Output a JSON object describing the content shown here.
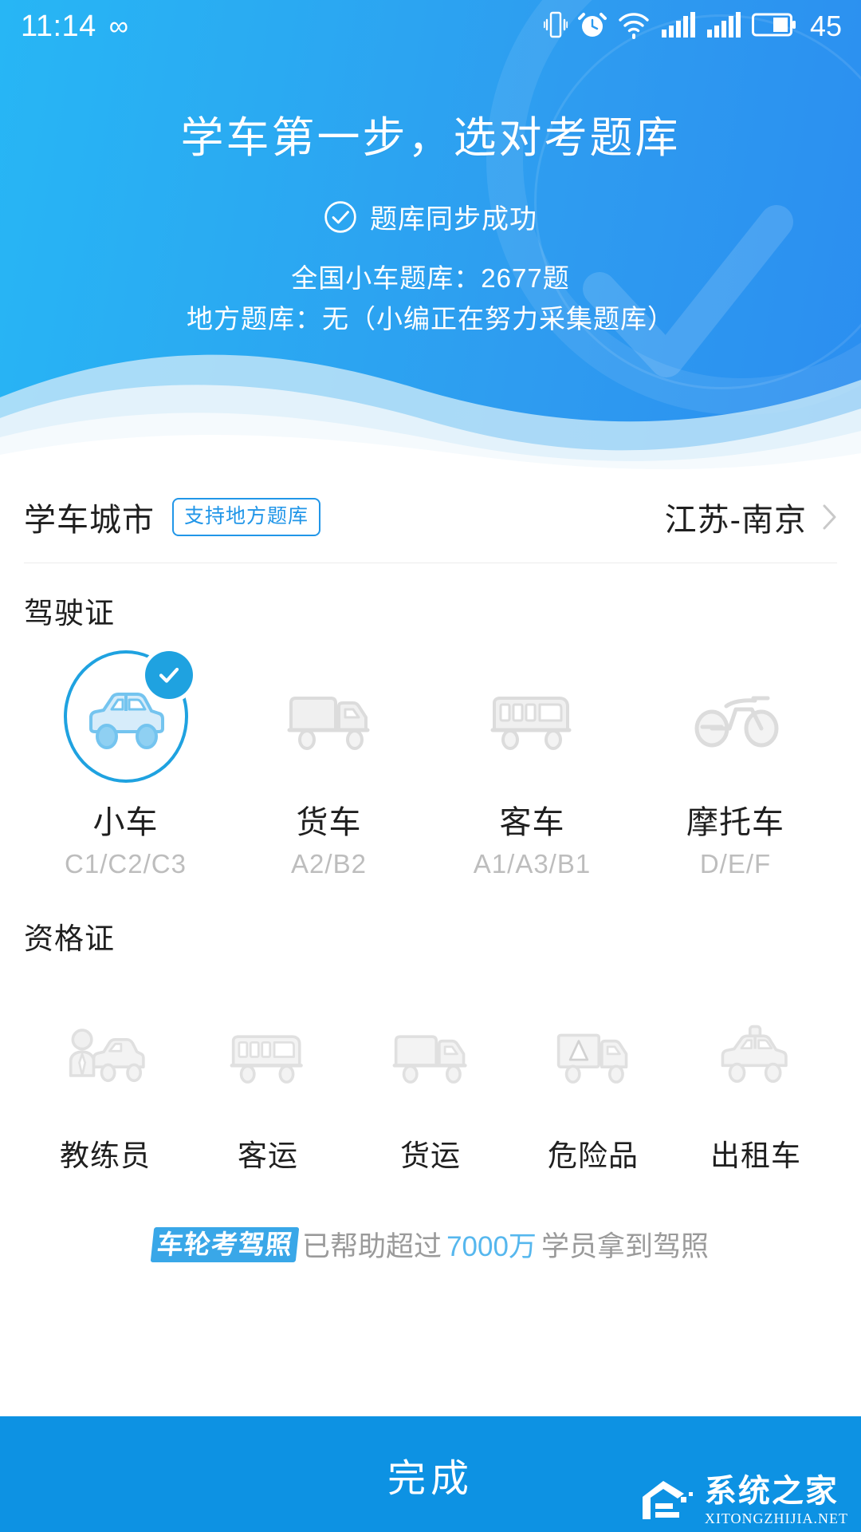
{
  "status_bar": {
    "time": "11:14",
    "infinity_glyph": "∞",
    "battery_level": "45",
    "icons": [
      "vibrate-icon",
      "alarm-icon",
      "wifi-icon",
      "signal-icon",
      "signal2-icon",
      "battery-icon"
    ]
  },
  "header": {
    "title": "学车第一步，选对考题库",
    "sync_status": "题库同步成功",
    "info_line_1": "全国小车题库：2677题",
    "info_line_2": "地方题库：无（小编正在努力采集题库）",
    "bank_count": "2677",
    "gradient_from": "#27b6f5",
    "gradient_to": "#2b8ef0"
  },
  "city_row": {
    "label": "学车城市",
    "badge": "支持地方题库",
    "value": "江苏-南京",
    "badge_color": "#2196e8"
  },
  "license_section": {
    "title": "驾驶证",
    "items": [
      {
        "label": "小车",
        "sub": "C1/C2/C3",
        "icon": "car-icon",
        "selected": true
      },
      {
        "label": "货车",
        "sub": "A2/B2",
        "icon": "truck-icon",
        "selected": false
      },
      {
        "label": "客车",
        "sub": "A1/A3/B1",
        "icon": "bus-icon",
        "selected": false
      },
      {
        "label": "摩托车",
        "sub": "D/E/F",
        "icon": "motorcycle-icon",
        "selected": false
      }
    ]
  },
  "qualification_section": {
    "title": "资格证",
    "items": [
      {
        "label": "教练员",
        "icon": "coach-icon",
        "selected": false
      },
      {
        "label": "客运",
        "icon": "passenger-transport-icon",
        "selected": false
      },
      {
        "label": "货运",
        "icon": "freight-icon",
        "selected": false
      },
      {
        "label": "危险品",
        "icon": "hazmat-icon",
        "selected": false
      },
      {
        "label": "出租车",
        "icon": "taxi-icon",
        "selected": false
      }
    ]
  },
  "promo": {
    "logo_text": "车轮考驾照",
    "prefix": "已帮助超过",
    "number": "7000万",
    "suffix": "学员拿到驾照"
  },
  "bottom_action": {
    "label": "完成",
    "background": "#0d92e3"
  },
  "watermark": {
    "cn": "系统之家",
    "en": "XITONGZHIJIA.NET"
  }
}
